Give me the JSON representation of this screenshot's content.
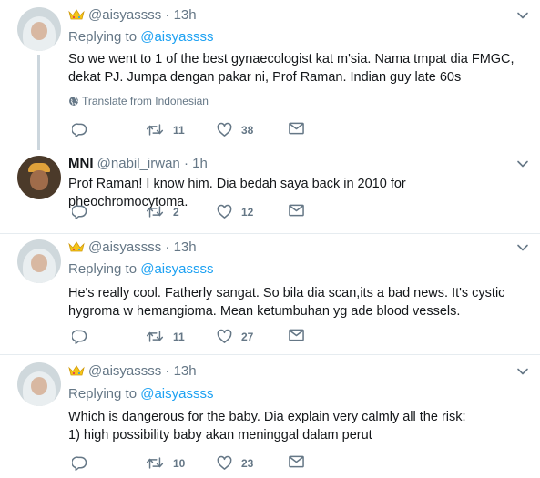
{
  "tweets": [
    {
      "display_name": "",
      "handle": "@aisyassss",
      "time": "· 13h",
      "replying_label": "Replying to",
      "replying_to": "@aisyassss",
      "lines": [
        "So we went to 1 of the best gynaecologist kat m'sia. Nama tmpat dia FMGC,",
        "dekat PJ. Jumpa dengan pakar ni, Prof Raman. Indian guy late 60s"
      ],
      "translate": "Translate from Indonesian",
      "retweets": "11",
      "likes": "38"
    },
    {
      "display_name": "MNI",
      "handle": "@nabil_irwan",
      "time": "· 1h",
      "lines": [
        "Prof Raman! I know him. Dia bedah saya back in 2010 for pheochromocytoma."
      ],
      "retweets": "2",
      "likes": "12"
    },
    {
      "display_name": "",
      "handle": "@aisyassss",
      "time": "· 13h",
      "replying_label": "Replying to",
      "replying_to": "@aisyassss",
      "lines": [
        "He's really cool. Fatherly sangat. So bila dia scan,its a bad news. It's cystic",
        "hygroma w hemangioma. Mean ketumbuhan yg ade blood vessels."
      ],
      "retweets": "11",
      "likes": "27"
    },
    {
      "display_name": "",
      "handle": "@aisyassss",
      "time": "· 13h",
      "replying_label": "Replying to",
      "replying_to": "@aisyassss",
      "lines": [
        "Which is dangerous for the baby. Dia explain very calmly all the risk:",
        "1) high possibility baby akan meninggal dalam perut"
      ],
      "retweets": "10",
      "likes": "23"
    }
  ],
  "colors": {
    "link": "#1da1f2",
    "muted": "#657786",
    "text": "#14171a",
    "border": "#e6ecf0",
    "thread": "#ccd6dd"
  },
  "icons": [
    "crown-emoji-icon",
    "chevron-down-icon",
    "globe-icon",
    "reply-icon",
    "retweet-icon",
    "like-icon",
    "message-icon"
  ]
}
